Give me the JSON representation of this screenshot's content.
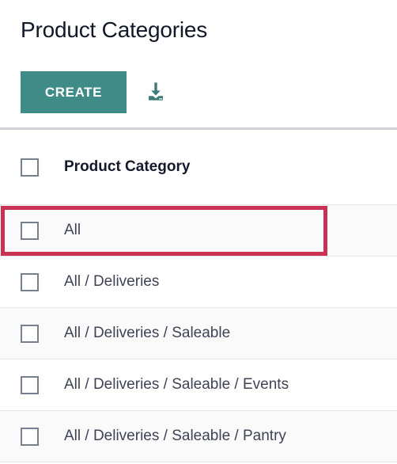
{
  "header": {
    "title": "Product Categories",
    "create_label": "CREATE",
    "import_icon": "download-import-icon"
  },
  "list": {
    "columns": [
      {
        "label": "Product Category"
      }
    ],
    "select_all_checkbox": "unchecked",
    "rows": [
      {
        "label": "All",
        "checkbox": "unchecked",
        "highlighted": true
      },
      {
        "label": "All / Deliveries",
        "checkbox": "unchecked",
        "highlighted": false
      },
      {
        "label": "All / Deliveries / Saleable",
        "checkbox": "unchecked",
        "highlighted": false
      },
      {
        "label": "All / Deliveries / Saleable / Events",
        "checkbox": "unchecked",
        "highlighted": false
      },
      {
        "label": "All / Deliveries / Saleable / Pantry",
        "checkbox": "unchecked",
        "highlighted": false
      }
    ]
  },
  "colors": {
    "primary_teal": "#3e8b88",
    "highlight_red": "#ca3254",
    "title_text": "#111827",
    "row_text": "#3f4354",
    "divider": "#d0d1d6",
    "row_border": "#e4e6ea",
    "zebra_row": "#fafafb",
    "checkbox_border": "#77808f"
  }
}
